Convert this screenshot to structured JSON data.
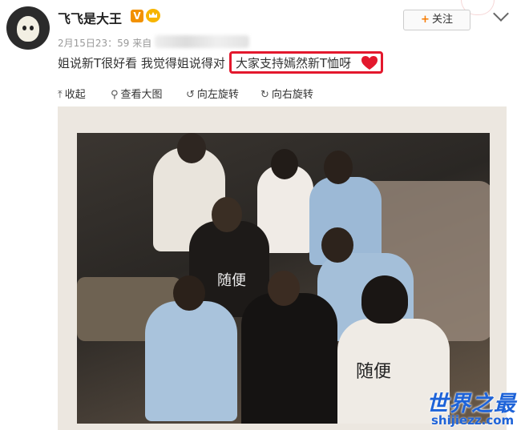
{
  "post": {
    "username": "飞飞是大王",
    "verified_badge": "V",
    "timestamp": "2月15日23：59 来自",
    "follow_label": "关注",
    "follow_plus": "+",
    "text_before": "姐说新T很好看 我觉得姐说得对",
    "text_highlighted": "大家支持嫣然新T恤呀"
  },
  "toolbar": {
    "collapse": "收起",
    "view_large": "查看大图",
    "rotate_left": "向左旋转",
    "rotate_right": "向右旋转"
  },
  "photo": {
    "shirt_text_1": "随便",
    "shirt_text_2": "随便"
  },
  "watermark": {
    "title": "世界之最",
    "url": "shijiezz.com"
  },
  "colors": {
    "highlight": "#e3182d",
    "watermark": "#1e63d8",
    "badge": "#f29100"
  }
}
